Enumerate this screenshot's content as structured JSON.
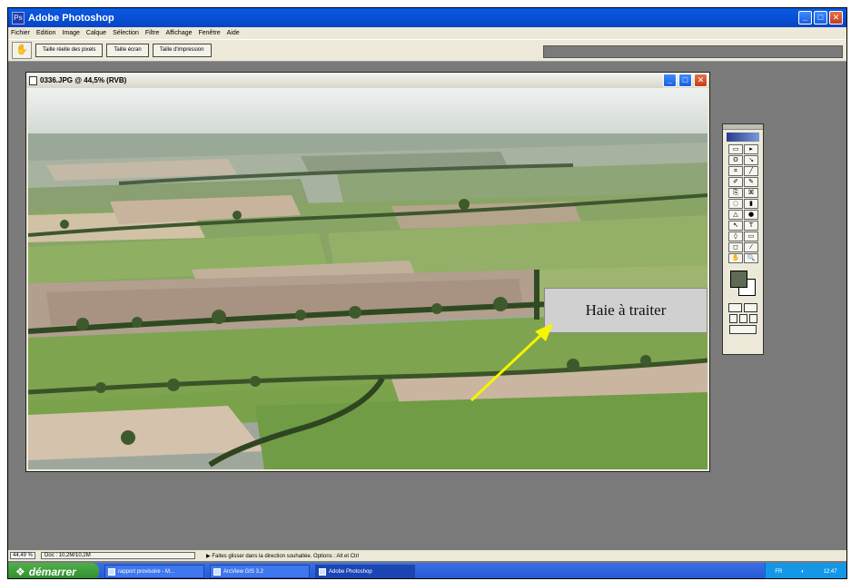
{
  "app": {
    "title": "Adobe Photoshop"
  },
  "menu": [
    "Fichier",
    "Edition",
    "Image",
    "Calque",
    "Sélection",
    "Filtre",
    "Affichage",
    "Fenêtre",
    "Aide"
  ],
  "options_bar": {
    "hand_icon": "hand-icon",
    "buttons": [
      "Taille réelle des pixels",
      "Taille écran",
      "Taille d'impression"
    ]
  },
  "document": {
    "title": "0336.JPG @ 44,5% (RVB)"
  },
  "callout": {
    "text": "Haie à traiter",
    "arrow_color": "#f5f500"
  },
  "tools": {
    "foreground_color": "#5f6b55",
    "background_color": "#ffffff",
    "rows": [
      [
        "▭",
        "▸"
      ],
      [
        "ʘ",
        "↘"
      ],
      [
        "⌗",
        "╱"
      ],
      [
        "✐",
        "✎"
      ],
      [
        "⎘",
        "⌘"
      ],
      [
        "◌",
        "▮"
      ],
      [
        "△",
        "●"
      ],
      [
        "↖",
        "T"
      ],
      [
        "◊",
        "▭"
      ],
      [
        "◻",
        "⁄"
      ],
      [
        "✋",
        "🔍"
      ]
    ]
  },
  "status": {
    "zoom": "44,49 %",
    "doc": "Doc : 10,2M/10,2M",
    "hint": "Faites glisser dans la direction souhaitée. Options : Alt et Ctrl"
  },
  "taskbar": {
    "start": "démarrer",
    "items": [
      "rapport provisoire - M...",
      "ArcView GIS 3.2",
      "Adobe Photoshop"
    ],
    "tray_lang": "FR",
    "clock": "12:47"
  }
}
